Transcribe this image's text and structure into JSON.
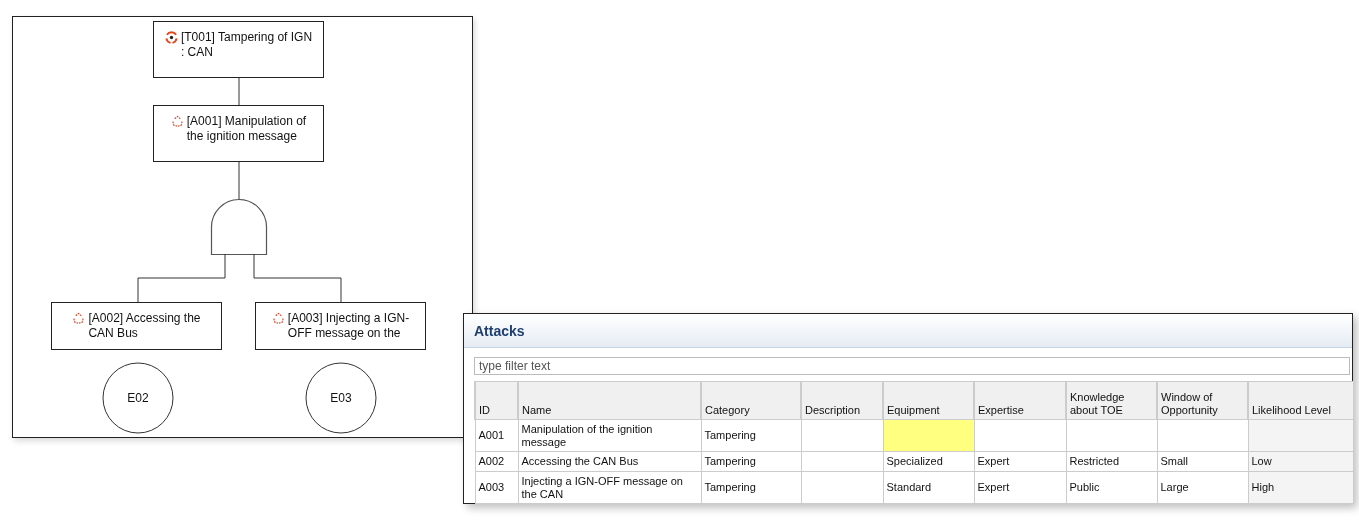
{
  "attack_tree": {
    "root": {
      "kind": "threat",
      "lines": [
        "[T001] Tampering of IGN",
        ": CAN"
      ],
      "children": [
        {
          "kind": "attack",
          "lines": [
            "[A001] Manipulation of",
            "the ignition message"
          ],
          "gate": {
            "kind": "and"
          },
          "children": [
            {
              "kind": "attack",
              "lines": [
                "[A002] Accessing the",
                "CAN Bus"
              ],
              "event": "E02"
            },
            {
              "kind": "attack",
              "lines": [
                "[A003] Injecting a IGN-",
                "OFF message on the"
              ],
              "event": "E03"
            }
          ]
        }
      ]
    }
  },
  "attacks_panel": {
    "title": "Attacks",
    "filter": {
      "placeholder": "type filter text"
    },
    "columns": [
      "ID",
      "Name",
      "Category",
      "Description",
      "Equipment",
      "Expertise",
      "Knowledge about TOE",
      "Window of Opportunity",
      "Likelihood Level"
    ],
    "rows": [
      {
        "id": "A001",
        "name": "Manipulation of the ignition message",
        "category": "Tampering",
        "equipment_highlighted": true
      },
      {
        "id": "A002",
        "name": "Accessing the CAN Bus",
        "category": "Tampering",
        "equipment": "Specialized",
        "expertise": "Expert",
        "knowledge": "Restricted",
        "window": "Small",
        "likelihood": "Low",
        "equipment_highlighted": false
      },
      {
        "id": "A003",
        "name": "Injecting a IGN-OFF message on the CAN",
        "category": "Tampering",
        "equipment": "Standard",
        "expertise": "Expert",
        "knowledge": "Public",
        "window": "Large",
        "likelihood": "High",
        "equipment_highlighted": false
      }
    ]
  }
}
